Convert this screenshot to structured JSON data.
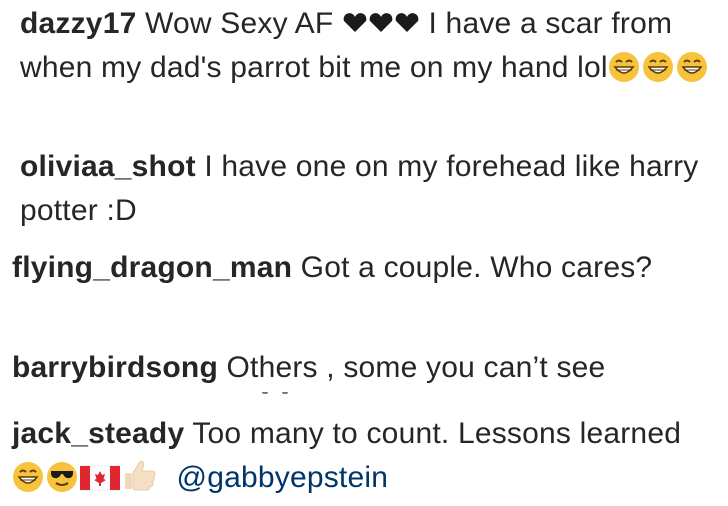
{
  "comments": [
    {
      "username": "dazzy17",
      "text_before_hearts": "Wow Sexy AF",
      "text_after_hearts": "I have a scar from when my dad's parrot bit me on my hand lol",
      "hearts": [
        "black-heart-icon",
        "black-heart-icon",
        "black-heart-icon"
      ],
      "emojis": [
        "grinning-face-icon",
        "grinning-face-icon",
        "grinning-face-icon"
      ]
    },
    {
      "username": "oliviaa_shot",
      "text": "I have one on my forehead like harry potter :D"
    },
    {
      "username": "flying_dragon_man",
      "text": "Got a couple. Who cares?"
    },
    {
      "username": "barrybirdsong",
      "text": "Others , some you can’t see"
    },
    {
      "username": "jack_steady",
      "text": "Too many to count. Lessons learned",
      "emojis": [
        "grinning-face-icon",
        "sunglasses-face-icon",
        "canada-flag-icon",
        "thumbs-up-icon"
      ],
      "mention": "@gabbyepstein"
    }
  ],
  "colors": {
    "text": "#262626",
    "mention": "#003569",
    "emoji_yellow": "#f7c33c",
    "flag_red": "#e1262f"
  }
}
